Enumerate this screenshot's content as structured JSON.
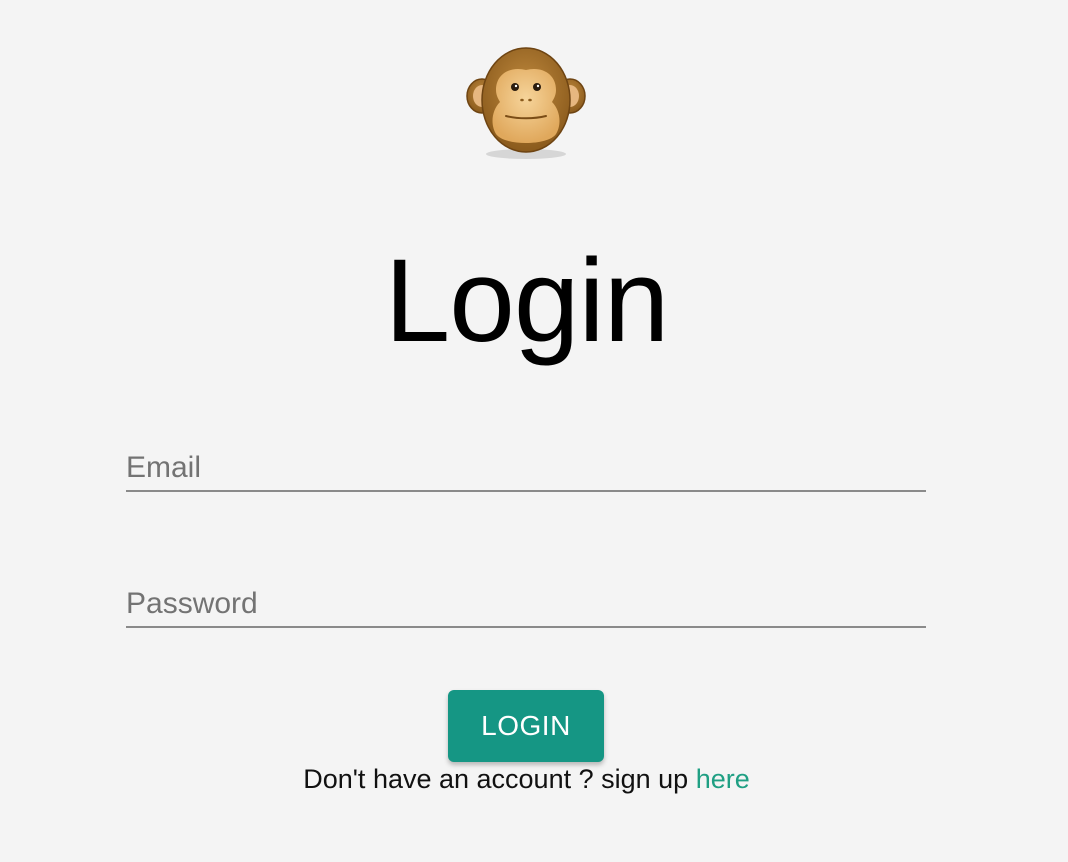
{
  "logo": {
    "icon": "monkey-face-icon"
  },
  "title": "Login",
  "form": {
    "email_placeholder": "Email",
    "password_placeholder": "Password",
    "login_label": "LOGIN"
  },
  "signup": {
    "prompt": "Don't have an account ? sign up ",
    "link_label": "here"
  },
  "colors": {
    "background": "#f4f4f4",
    "button": "#159684",
    "link": "#1f9f83",
    "underline": "#8a8a8a"
  }
}
